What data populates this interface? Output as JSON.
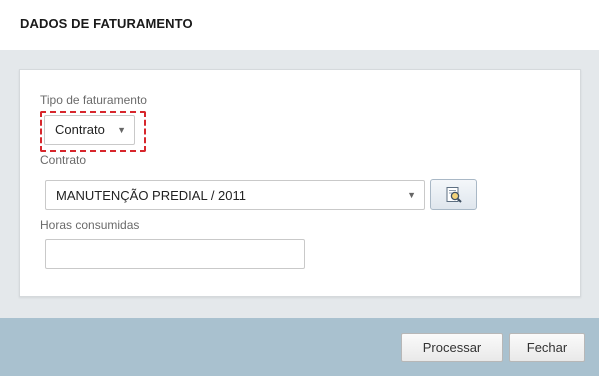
{
  "header": {
    "title": "DADOS DE FATURAMENTO"
  },
  "form": {
    "tipo_faturamento": {
      "label": "Tipo de faturamento",
      "value": "Contrato"
    },
    "contrato": {
      "label": "Contrato",
      "value": "MANUTENÇÃO PREDIAL / 2011",
      "lookup_icon": "search-document-icon"
    },
    "horas_consumidas": {
      "label": "Horas consumidas",
      "value": ""
    }
  },
  "footer": {
    "processar_label": "Processar",
    "fechar_label": "Fechar"
  },
  "colors": {
    "footer_bg": "#a9c1cf",
    "body_bg": "#e4e8eb",
    "focus_ring": "#d7262c"
  }
}
